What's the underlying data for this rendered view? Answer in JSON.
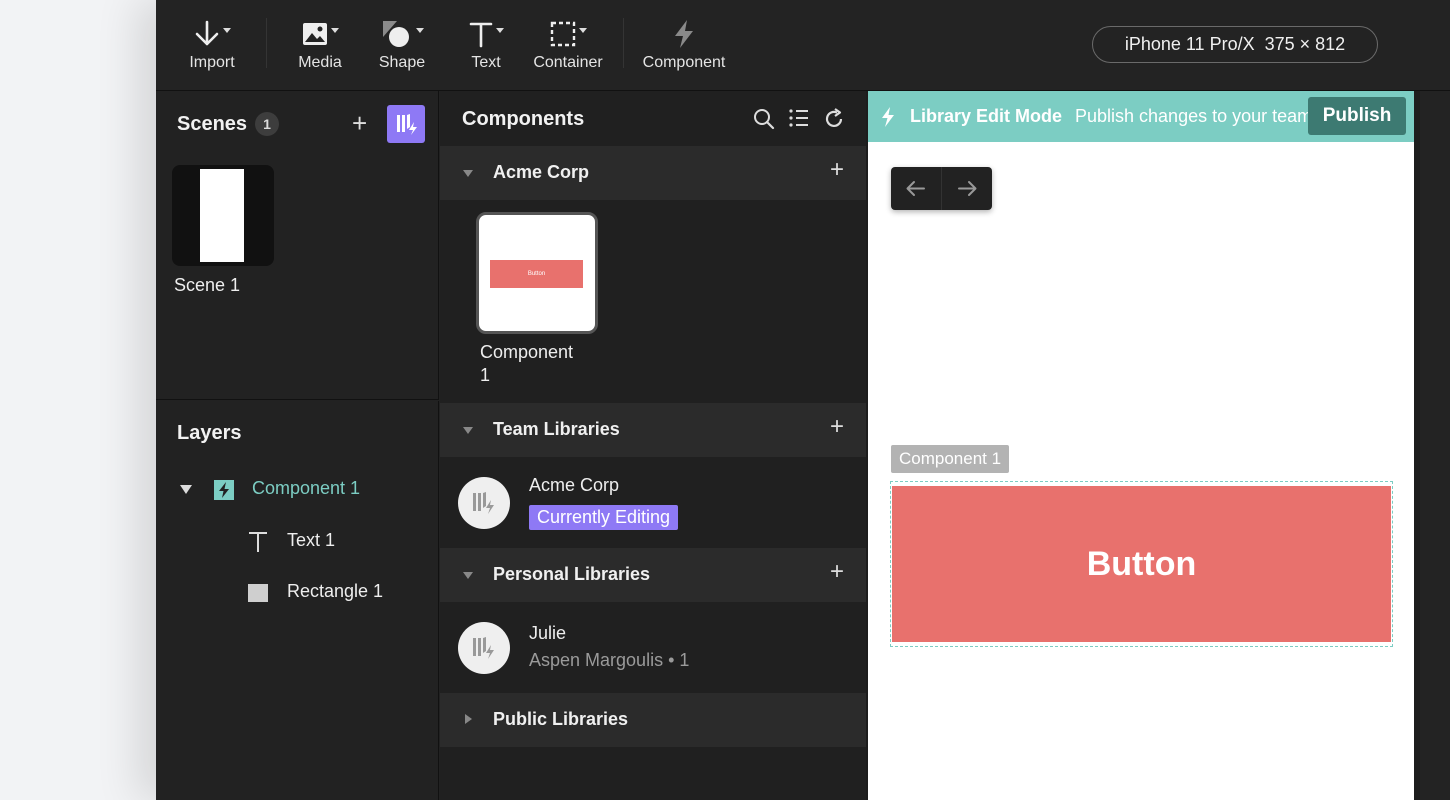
{
  "toolbar": {
    "import": "Import",
    "media": "Media",
    "shape": "Shape",
    "text": "Text",
    "container": "Container",
    "component": "Component",
    "device": "iPhone 11 Pro/X  375 × 812"
  },
  "scenes": {
    "title": "Scenes",
    "count": "1",
    "items": [
      {
        "label": "Scene 1"
      }
    ]
  },
  "layers": {
    "title": "Layers",
    "items": [
      {
        "label": "Component 1",
        "icon": "component-icon"
      },
      {
        "label": "Text 1",
        "icon": "text-icon"
      },
      {
        "label": "Rectangle 1",
        "icon": "rectangle-icon"
      }
    ]
  },
  "components": {
    "title": "Components",
    "acme_section": "Acme Corp",
    "component_thumb_text": "Button",
    "component_label_line1": "Component",
    "component_label_line2": "1",
    "team_section": "Team Libraries",
    "team_item_name": "Acme Corp",
    "team_item_badge": "Currently Editing",
    "personal_section": "Personal Libraries",
    "personal_item_name": "Julie",
    "personal_item_sub": "Aspen Margoulis • 1",
    "public_section": "Public Libraries"
  },
  "canvas": {
    "banner_title": "Library Edit Mode",
    "banner_text": "Publish changes to your team",
    "publish": "Publish",
    "component_tag": "Component 1",
    "button_text": "Button"
  },
  "colors": {
    "accent_purple": "#8e79f5",
    "teal": "#7ccdc3",
    "button_red": "#e8716d",
    "publish_bg": "#3d7a72"
  }
}
